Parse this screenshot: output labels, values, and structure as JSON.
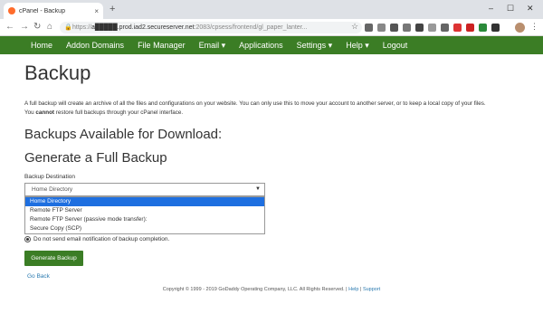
{
  "browser": {
    "tab_title": "cPanel - Backup",
    "tab_close": "×",
    "new_tab": "+",
    "window_controls": [
      "–",
      "☐",
      "✕"
    ],
    "url_prefix": "https://",
    "url_host": "a█████.prod.iad2.secureserver.net",
    "url_port": ":2083/cpsess",
    "url_path": "/frontend/gl_paper_lanter..."
  },
  "nav": {
    "items": [
      {
        "label": "Home"
      },
      {
        "label": "Addon Domains"
      },
      {
        "label": "File Manager"
      },
      {
        "label": "Email ▾"
      },
      {
        "label": "Applications"
      },
      {
        "label": "Settings ▾"
      },
      {
        "label": "Help ▾"
      },
      {
        "label": "Logout"
      }
    ]
  },
  "page": {
    "title": "Backup",
    "desc_line1": "A full backup will create an archive of all the files and configurations on your website. You can only use this to move your account to another server, or to keep a local copy of your files.",
    "desc_you": "You ",
    "desc_cannot": "cannot",
    "desc_rest": " restore full backups through your cPanel interface.",
    "available_heading": "Backups Available for Download:",
    "generate_heading": "Generate a Full Backup",
    "destination_label": "Backup Destination",
    "destination_selected": "Home Directory",
    "destination_options": [
      "Home Directory",
      "Remote FTP Server",
      "Remote FTP Server (passive mode transfer):",
      "Secure Copy (SCP)"
    ],
    "no_email_label": "Do not send email notification of backup completion.",
    "generate_button": "Generate Backup",
    "go_back": "Go Back"
  },
  "footer": {
    "copyright": "Copyright © 1999 - 2019 GoDaddy Operating Company, LLC. All Rights Reserved.",
    "sep": " | ",
    "help": "Help",
    "support": "Support"
  }
}
